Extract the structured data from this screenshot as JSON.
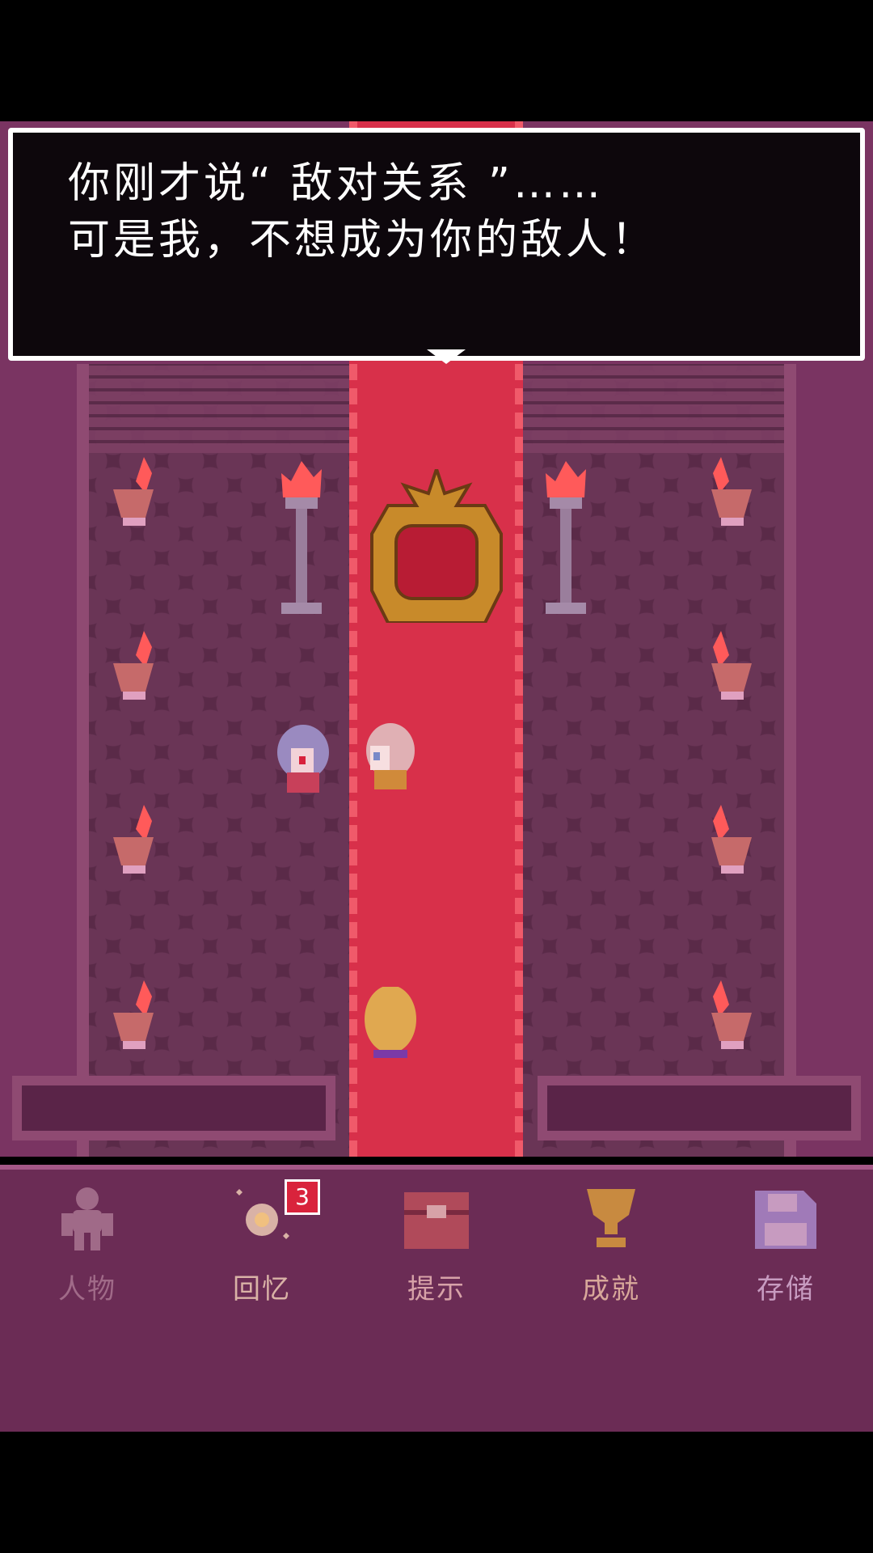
{
  "dialog": {
    "line1": "你刚才说“ 敌对关系 ”……",
    "line2": "可是我，不想成为你的敌人！"
  },
  "menu": {
    "items": [
      {
        "label": "人物",
        "icon": "person-icon",
        "color": "#a06a88"
      },
      {
        "label": "回忆",
        "icon": "memory-icon",
        "color": "#d9b2a6",
        "badge": "3"
      },
      {
        "label": "提示",
        "icon": "chest-icon",
        "color": "#d7a2a8"
      },
      {
        "label": "成就",
        "icon": "trophy-icon",
        "color": "#d8a89a"
      },
      {
        "label": "存储",
        "icon": "save-icon",
        "color": "#c79bc0"
      }
    ]
  },
  "colors": {
    "badge": "#d9233c",
    "carpet": "#d8304a",
    "menu_bg": "#6b2c55"
  }
}
